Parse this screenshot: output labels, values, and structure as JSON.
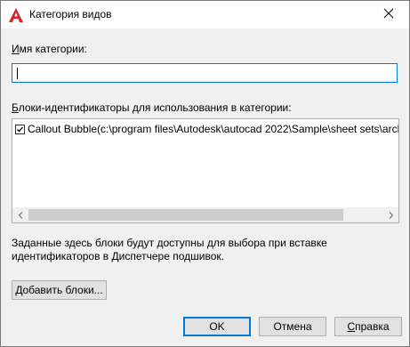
{
  "window": {
    "title": "Категория видов"
  },
  "category_name": {
    "label_underlined": "И",
    "label_rest": "мя категории:",
    "value": ""
  },
  "blocks": {
    "label_underlined": "Б",
    "label_rest": "локи-идентификаторы для использования в категории:",
    "items": [
      {
        "checked": true,
        "text": "Callout Bubble(c:\\program files\\Autodesk\\autocad 2022\\Sample\\sheet sets\\architectural\\"
      }
    ]
  },
  "info_text": "Заданные здесь блоки будут доступны для выбора при вставке идентификаторов в Диспетчере подшивок.",
  "buttons": {
    "add_underlined": "Д",
    "add_rest": "обавить блоки...",
    "ok": "OK",
    "cancel": "Отмена",
    "help_underlined": "С",
    "help_rest": "правка"
  },
  "colors": {
    "accent": "#0078d7",
    "app_icon": "#d2232a"
  },
  "icons": {
    "app": "autocad-icon",
    "close": "close-icon"
  }
}
